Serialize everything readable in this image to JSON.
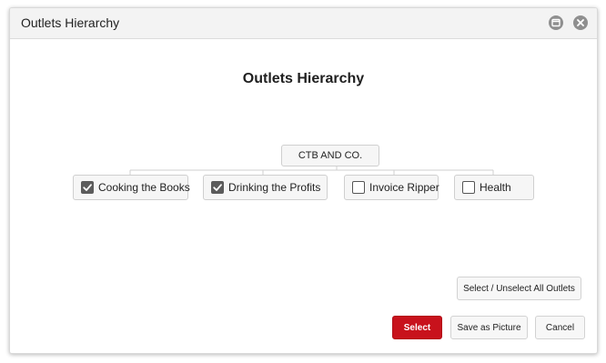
{
  "window": {
    "title": "Outlets Hierarchy",
    "maximize_icon": "window-maximize-icon",
    "close_icon": "close-icon"
  },
  "main": {
    "heading": "Outlets Hierarchy"
  },
  "tree": {
    "root": {
      "label": "CTB AND CO."
    },
    "children": [
      {
        "label": "Cooking the Books",
        "checked": true
      },
      {
        "label": "Drinking the Profits",
        "checked": true
      },
      {
        "label": "Invoice Ripper",
        "checked": false
      },
      {
        "label": "Health",
        "checked": false
      }
    ]
  },
  "buttons": {
    "select_all": "Select / Unselect All Outlets",
    "select": "Select",
    "save_picture": "Save as Picture",
    "cancel": "Cancel"
  },
  "colors": {
    "primary_button": "#c8121c",
    "checkbox_checked": "#5b5b5b",
    "titlebar": "#f3f3f3"
  }
}
